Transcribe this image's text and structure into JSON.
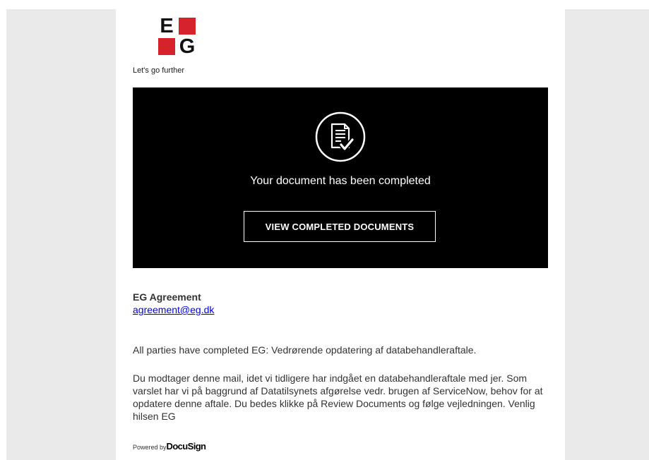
{
  "brand": {
    "logo_letters": [
      "E",
      "G"
    ],
    "tagline": "Let's go further",
    "red": "#d6232b"
  },
  "hero": {
    "icon": "document-check-icon",
    "message": "Your document has been completed",
    "button_label": "VIEW COMPLETED DOCUMENTS"
  },
  "sender": {
    "name": "EG Agreement",
    "email": "agreement@eg.dk"
  },
  "body": {
    "summary": "All parties have completed EG: Vedrørende opdatering af databehandleraftale.",
    "message": "Du modtager denne mail, idet vi tidligere har indgået en databehandleraftale med jer. Som varslet har vi på baggrund af Datatilsynets afgørelse vedr. brugen af ServiceNow, behov for at opdatere denne aftale. Du bedes klikke på Review Documents og følge vejledningen. Venlig hilsen EG"
  },
  "footer": {
    "powered_by": "Powered by",
    "provider": "DocuSign"
  }
}
